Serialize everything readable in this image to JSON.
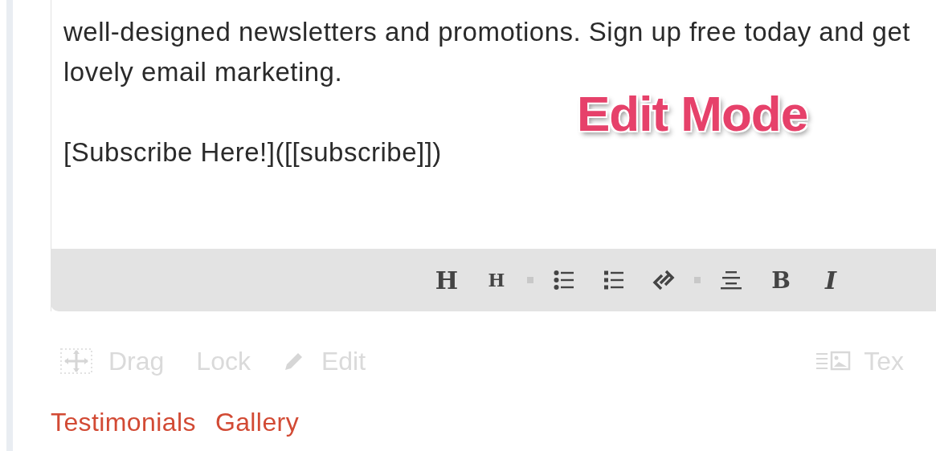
{
  "editor": {
    "paragraphs": [
      {
        "lines": [
          "well-designed newsletters and promotions. Sign up free today and get",
          "lovely email marketing."
        ]
      },
      {
        "lines": [
          "[Subscribe Here!]([[subscribe]])"
        ]
      }
    ]
  },
  "overlay_label": "Edit Mode",
  "toolbar": [
    {
      "kind": "heading-large",
      "label": "H"
    },
    {
      "kind": "heading-small",
      "label": "H"
    },
    {
      "kind": "separator"
    },
    {
      "kind": "bullet-list"
    },
    {
      "kind": "numbered-list"
    },
    {
      "kind": "unlink"
    },
    {
      "kind": "separator"
    },
    {
      "kind": "align-center"
    },
    {
      "kind": "bold",
      "label": "B"
    },
    {
      "kind": "italic",
      "label": "I"
    }
  ],
  "block_controls": [
    {
      "kind": "drag",
      "label": "Drag"
    },
    {
      "kind": "lock",
      "label": "Lock"
    },
    {
      "kind": "edit",
      "label": "Edit"
    }
  ],
  "block_type": {
    "kind": "text-image",
    "label": "Tex"
  },
  "links": [
    "Testimonials",
    "Gallery"
  ]
}
